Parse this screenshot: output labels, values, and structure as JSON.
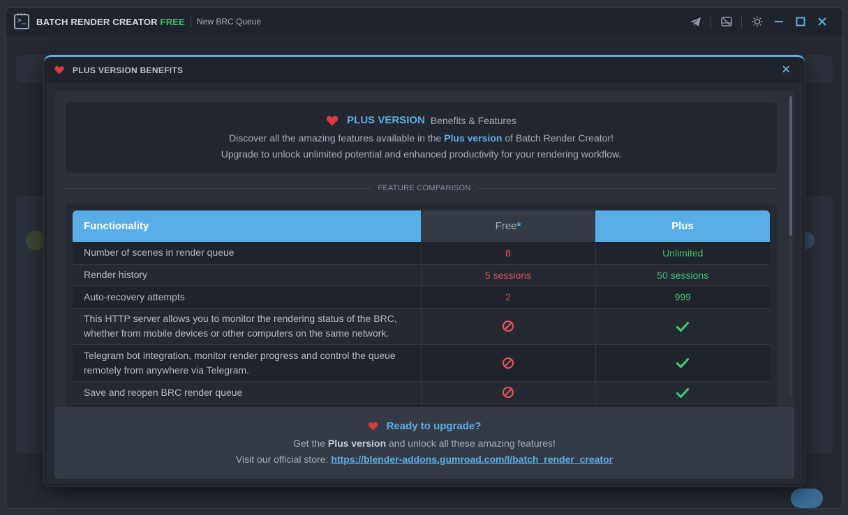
{
  "app": {
    "title": "BATCH RENDER CREATOR",
    "edition": "FREE",
    "queue_name": "New BRC Queue",
    "icons": [
      "telegram-icon",
      "http-server-icon",
      "theme-icon",
      "minimize-icon",
      "maximize-icon",
      "close-icon"
    ]
  },
  "modal": {
    "title": "PLUS VERSION BENEFITS",
    "close_label": "✕"
  },
  "intro": {
    "plus_label": "PLUS VERSION",
    "subtitle": "Benefits & Features",
    "line1_pre": "Discover all the amazing features available in the",
    "line1_hl": "Plus version",
    "line1_post": "of Batch Render Creator!",
    "line2": "Upgrade to unlock unlimited potential and enhanced productivity for your rendering workflow."
  },
  "comparison": {
    "section_label": "FEATURE COMPARISON",
    "headers": {
      "functionality": "Functionality",
      "free": "Free",
      "free_mark": "*",
      "plus": "Plus"
    },
    "rows": [
      {
        "feature": "Number of scenes in render queue",
        "free": "8",
        "plus": "Unlimited"
      },
      {
        "feature": "Render history",
        "free": "5 sessions",
        "plus": "50 sessions"
      },
      {
        "feature": "Auto-recovery attempts",
        "free": "2",
        "plus": "999"
      },
      {
        "feature": "This HTTP server allows you to monitor the rendering status of the BRC, whether from mobile devices or other computers on the same network.",
        "free_icon": "not-available-icon",
        "plus_icon": "check-icon"
      },
      {
        "feature": "Telegram bot integration, monitor render progress and control the queue remotely from anywhere via Telegram.",
        "free_icon": "not-available-icon",
        "plus_icon": "check-icon"
      },
      {
        "feature": "Save and reopen BRC render queue",
        "free_icon": "not-available-icon",
        "plus_icon": "check-icon"
      }
    ]
  },
  "footer": {
    "title": "Ready to upgrade?",
    "line1_pre": "Get the",
    "line1_hl": "Plus version",
    "line1_post": "and unlock all these amazing features!",
    "line2_pre": "Visit our official store:",
    "store_link": "https://blender-addons.gumroad.com/l/batch_render_creator"
  },
  "colors": {
    "accent": "#5aaee8",
    "free_value": "#e25454",
    "plus_value": "#3ec46d",
    "heart": "#e0393e"
  }
}
